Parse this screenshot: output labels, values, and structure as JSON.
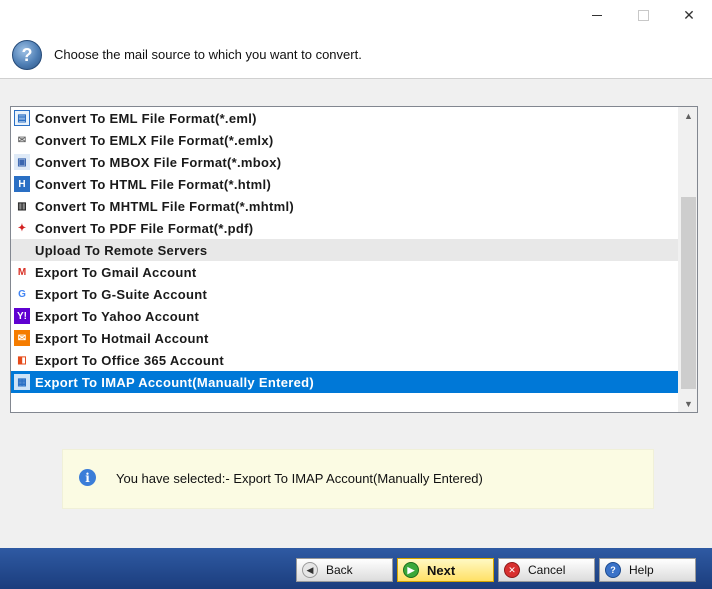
{
  "window": {
    "minimize_symbol": "",
    "maximize_symbol": "",
    "close_symbol": "✕"
  },
  "header": {
    "icon": "help-icon",
    "icon_glyph": "?",
    "text": "Choose the mail source to which you want to convert."
  },
  "list": {
    "items": [
      {
        "label": "Convert To EML File Format(*.eml)",
        "icon": "eml-file-icon",
        "kind": "item"
      },
      {
        "label": "Convert To EMLX File Format(*.emlx)",
        "icon": "envelope-icon",
        "kind": "item"
      },
      {
        "label": "Convert To MBOX File Format(*.mbox)",
        "icon": "mbox-file-icon",
        "kind": "item"
      },
      {
        "label": "Convert To HTML File Format(*.html)",
        "icon": "html-file-icon",
        "kind": "item"
      },
      {
        "label": "Convert To MHTML File Format(*.mhtml)",
        "icon": "mhtml-file-icon",
        "kind": "item"
      },
      {
        "label": "Convert To PDF File Format(*.pdf)",
        "icon": "pdf-file-icon",
        "kind": "item"
      },
      {
        "label": "Upload To Remote Servers",
        "icon": "",
        "kind": "group"
      },
      {
        "label": "Export To Gmail Account",
        "icon": "gmail-icon",
        "kind": "item"
      },
      {
        "label": "Export To G-Suite Account",
        "icon": "google-icon",
        "kind": "item"
      },
      {
        "label": "Export To Yahoo Account",
        "icon": "yahoo-icon",
        "kind": "item"
      },
      {
        "label": "Export To Hotmail Account",
        "icon": "hotmail-icon",
        "kind": "item"
      },
      {
        "label": "Export To Office 365 Account",
        "icon": "office365-icon",
        "kind": "item"
      },
      {
        "label": "Export To IMAP Account(Manually Entered)",
        "icon": "imap-server-icon",
        "kind": "selected"
      }
    ],
    "scroll_up_glyph": "▲",
    "scroll_down_glyph": "▼"
  },
  "info": {
    "glyph": "i",
    "text": "You have selected:- Export To IMAP Account(Manually Entered)"
  },
  "buttons": {
    "back": {
      "label": "Back",
      "glyph": "◀"
    },
    "next": {
      "label": "Next",
      "glyph": "▶"
    },
    "cancel": {
      "label": "Cancel",
      "glyph": "✕"
    },
    "help": {
      "label": "Help",
      "glyph": "?"
    }
  },
  "colors": {
    "selection": "#0078d7",
    "bottom_bar": "#2f5aa3",
    "info_background": "#fbfbe3"
  }
}
